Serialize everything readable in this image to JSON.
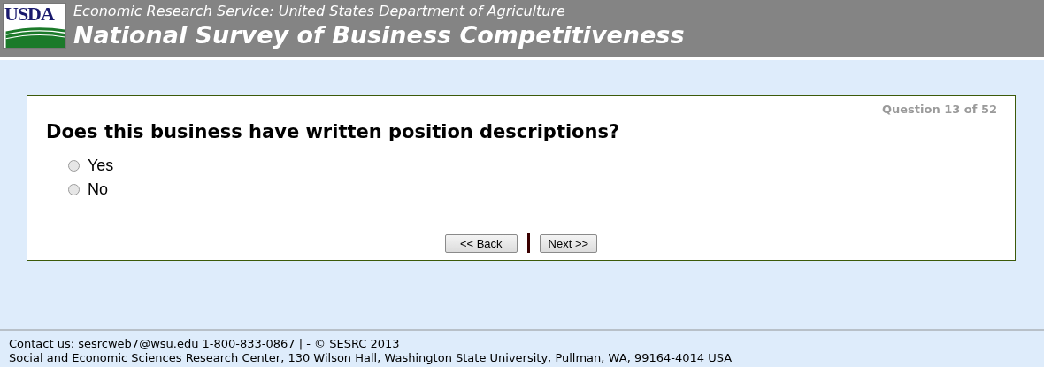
{
  "header": {
    "logo_text": "USDA",
    "agency": "Economic Research Service: United States Department of Agriculture",
    "title": "National Survey of Business Competitiveness"
  },
  "question": {
    "counter": "Question 13 of 52",
    "text": "Does this business have written position descriptions?",
    "options": [
      {
        "label": "Yes",
        "selected": false
      },
      {
        "label": "No",
        "selected": false
      }
    ]
  },
  "buttons": {
    "back": "<< Back",
    "next": "Next >>"
  },
  "footer": {
    "contact": "Contact us: sesrcweb7@wsu.edu 1-800-833-0867 | - © SESRC 2013",
    "address": "Social and Economic Sciences Research Center, 130 Wilson Hall, Washington State University, Pullman, WA, 99164-4014 USA"
  }
}
